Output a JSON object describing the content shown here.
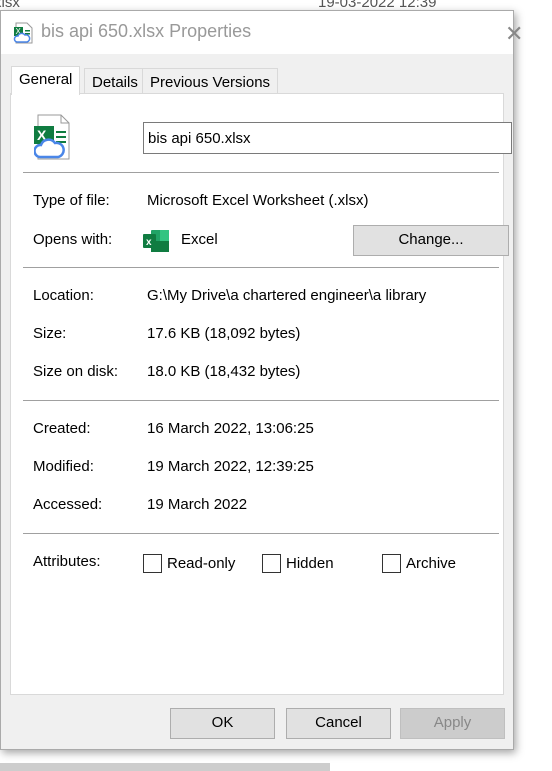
{
  "background": {
    "file_fragment": "xlsx",
    "date_fragment": "19-03-2022 12:39"
  },
  "window": {
    "title": "bis api 650.xlsx Properties",
    "close": "✕"
  },
  "tabs": [
    {
      "label": "General",
      "active": true
    },
    {
      "label": "Details"
    },
    {
      "label": "Previous Versions"
    }
  ],
  "file": {
    "name": "bis api 650.xlsx",
    "icon": "excel-cloud-file-icon"
  },
  "type": {
    "label": "Type of file:",
    "value": "Microsoft Excel Worksheet (.xlsx)"
  },
  "opens": {
    "label": "Opens with:",
    "app": "Excel",
    "app_icon": "excel-icon",
    "change": "Change..."
  },
  "location": {
    "label": "Location:",
    "value": "G:\\My Drive\\a chartered engineer\\a library"
  },
  "size": {
    "label": "Size:",
    "value": "17.6 KB (18,092 bytes)"
  },
  "size_on_disk": {
    "label": "Size on disk:",
    "value": "18.0 KB (18,432 bytes)"
  },
  "created": {
    "label": "Created:",
    "value": "16 March 2022, 13:06:25"
  },
  "modified": {
    "label": "Modified:",
    "value": "19 March 2022, 12:39:25"
  },
  "accessed": {
    "label": "Accessed:",
    "value": "19 March 2022"
  },
  "attributes": {
    "label": "Attributes:",
    "readonly": {
      "label": "Read-only",
      "checked": false
    },
    "hidden": {
      "label": "Hidden",
      "checked": false
    },
    "archive": {
      "label": "Archive",
      "checked": false
    }
  },
  "buttons": {
    "ok": "OK",
    "cancel": "Cancel",
    "apply": "Apply"
  },
  "colors": {
    "excel_green": "#107c41",
    "cloud_blue": "#4a86e8"
  }
}
